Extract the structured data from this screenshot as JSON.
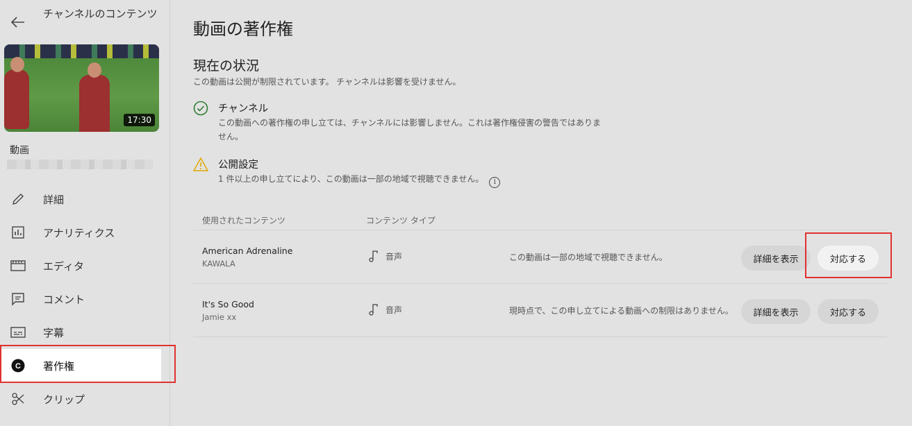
{
  "sidebar": {
    "channel_title": "チャンネルのコンテンツ",
    "video_duration": "17:30",
    "video_label": "動画",
    "nav": [
      {
        "label": "詳細",
        "icon": "pencil-icon"
      },
      {
        "label": "アナリティクス",
        "icon": "analytics-icon"
      },
      {
        "label": "エディタ",
        "icon": "editor-icon"
      },
      {
        "label": "コメント",
        "icon": "comment-icon"
      },
      {
        "label": "字幕",
        "icon": "subtitles-icon"
      },
      {
        "label": "著作権",
        "icon": "copyright-icon",
        "active": true
      },
      {
        "label": "クリップ",
        "icon": "scissors-icon"
      }
    ]
  },
  "main": {
    "page_title": "動画の著作権",
    "section_title": "現在の状況",
    "section_sub": "この動画は公開が制限されています。 チャンネルは影響を受けません。",
    "status": [
      {
        "title": "チャンネル",
        "text": "この動画への著作権の申し立ては、チャンネルには影響しません。これは著作権侵害の警告ではありません。",
        "icon": "check-circle-icon"
      },
      {
        "title": "公開設定",
        "text": "1 件以上の申し立てにより、この動画は一部の地域で視聴できません。",
        "icon": "warning-icon"
      }
    ],
    "table": {
      "headers": [
        "使用されたコンテンツ",
        "コンテンツ タイプ"
      ],
      "rows": [
        {
          "song": "American Adrenaline",
          "artist": "KAWALA",
          "type": "音声",
          "impact": "この動画は一部の地域で視聴できません。",
          "details_label": "詳細を表示",
          "action_label": "対応する"
        },
        {
          "song": "It's So Good",
          "artist": "Jamie xx",
          "type": "音声",
          "impact": "現時点で、この申し立てによる動画への制限はありません。",
          "details_label": "詳細を表示",
          "action_label": "対応する"
        }
      ]
    }
  },
  "colors": {
    "accent_highlight": "#e0322f",
    "check": "#2e7d32",
    "warning": "#e0a800"
  }
}
